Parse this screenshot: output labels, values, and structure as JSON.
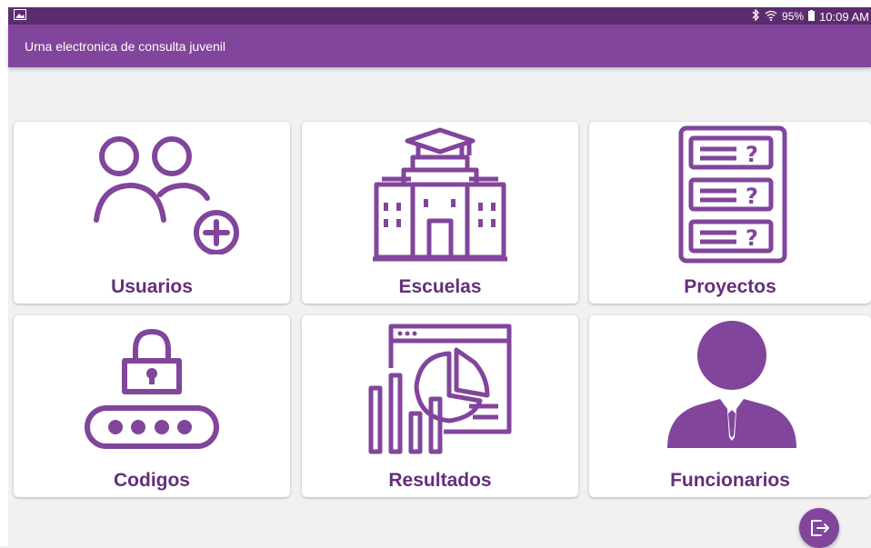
{
  "status_bar": {
    "battery": "95%",
    "time": "10:09 AM",
    "icons": [
      "image-icon",
      "bluetooth-icon",
      "wifi-icon",
      "battery-icon"
    ]
  },
  "app_bar": {
    "title": "Urna electronica de consulta juvenil"
  },
  "menu": {
    "items": [
      {
        "label": "Usuarios",
        "icon": "add-users-icon"
      },
      {
        "label": "Escuelas",
        "icon": "school-building-icon"
      },
      {
        "label": "Proyectos",
        "icon": "question-list-icon"
      },
      {
        "label": "Codigos",
        "icon": "lock-code-icon"
      },
      {
        "label": "Resultados",
        "icon": "results-chart-icon"
      },
      {
        "label": "Funcionarios",
        "icon": "official-person-icon"
      }
    ]
  },
  "fab": {
    "icon": "logout-icon"
  },
  "colors": {
    "primary": "#81459b",
    "primary_dark": "#5c2d6e",
    "label": "#642f7a",
    "background": "#f1f1f1"
  }
}
